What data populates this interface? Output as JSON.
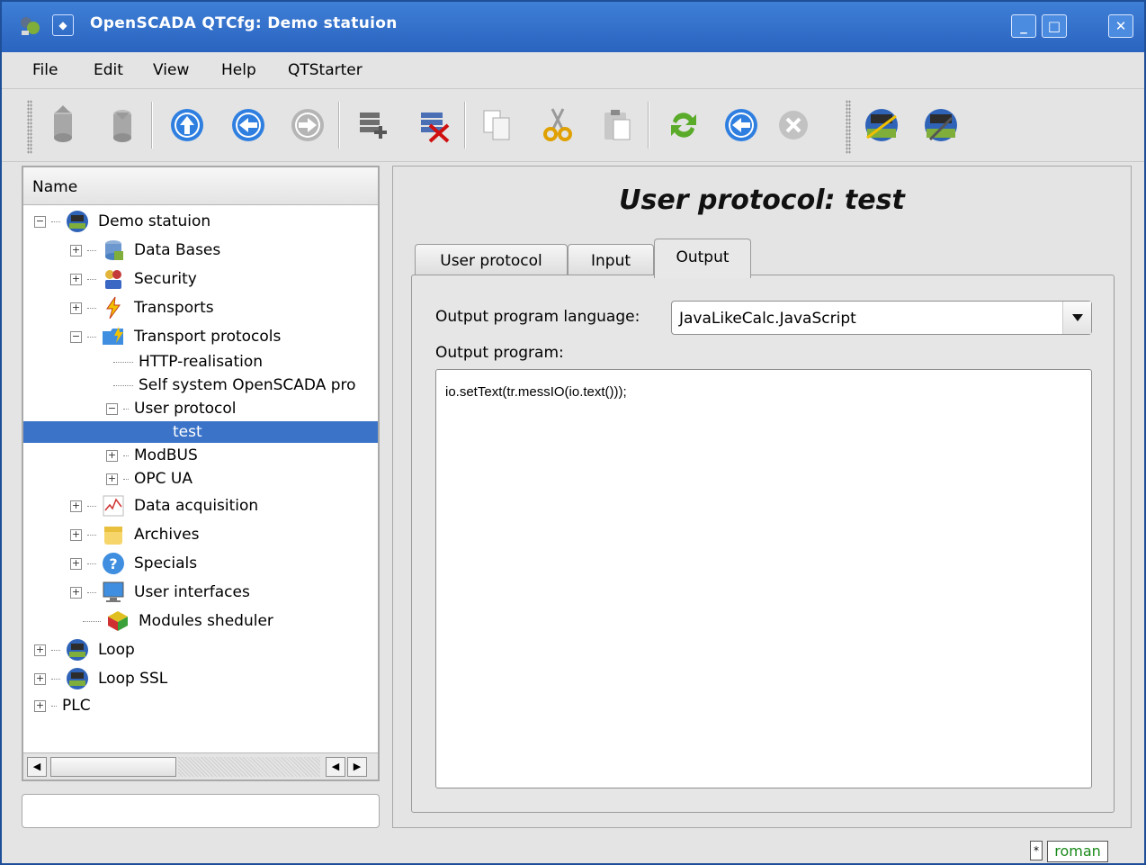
{
  "window": {
    "title": "OpenSCADA QTCfg: Demo statuion"
  },
  "menu": {
    "items": [
      "File",
      "Edit",
      "View",
      "Help",
      "QTStarter"
    ]
  },
  "toolbar": {
    "buttons": [
      "db-load-icon",
      "db-save-icon",
      "up-icon",
      "back-icon",
      "forward-icon",
      "add-item-icon",
      "delete-item-icon",
      "copy-icon",
      "cut-icon",
      "paste-icon",
      "refresh-icon",
      "start-icon",
      "stop-icon",
      "station-connect-icon",
      "station-disconnect-icon"
    ]
  },
  "tree": {
    "header": "Name",
    "nodes": [
      "Demo statuion",
      "Data Bases",
      "Security",
      "Transports",
      "Transport protocols",
      "HTTP-realisation",
      "Self system OpenSCADA pro",
      "User protocol",
      "test",
      "ModBUS",
      "OPC UA",
      "Data acquisition",
      "Archives",
      "Specials",
      "User interfaces",
      "Modules sheduler",
      "Loop",
      "Loop SSL",
      "PLC"
    ]
  },
  "page": {
    "title": "User protocol: test",
    "tabs": [
      "User protocol",
      "Input",
      "Output"
    ],
    "active_tab": "Output",
    "lang_label": "Output program language:",
    "lang_value": "JavaLikeCalc.JavaScript",
    "program_label": "Output program:",
    "program_code": "io.setText(tr.messIO(io.text()));"
  },
  "status": {
    "modified_flag": "*",
    "user": "roman"
  },
  "colors": {
    "titlebar": "#2f6cc9",
    "selection": "#3a73c8",
    "user_text": "#1a8a1a"
  }
}
